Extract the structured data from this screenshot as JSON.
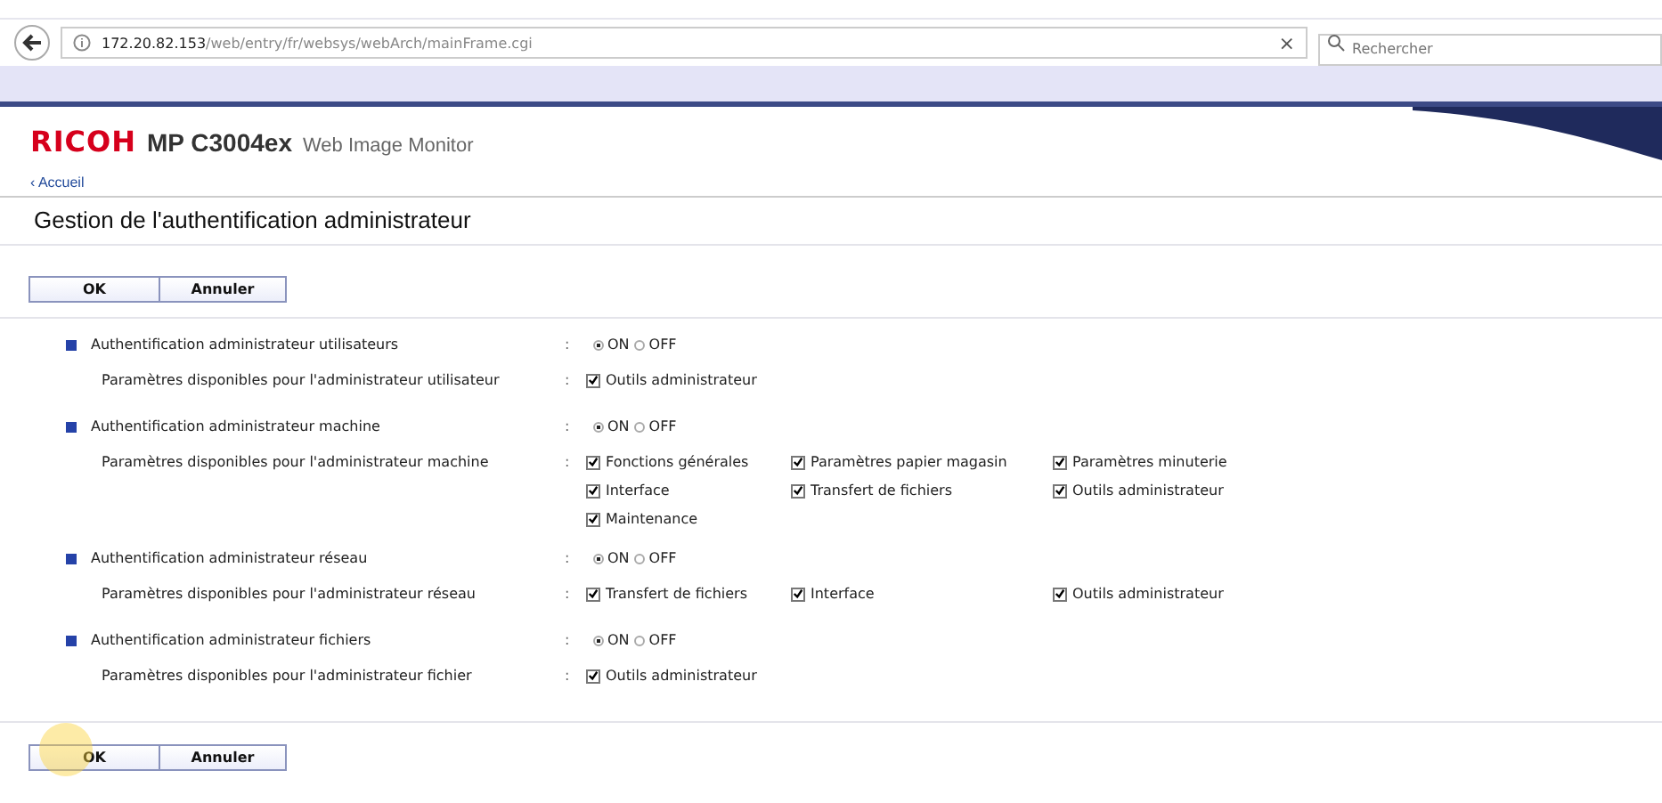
{
  "browser": {
    "url_host": "172.20.82.153",
    "url_path": "/web/entry/fr/websys/webArch/mainFrame.cgi",
    "clear": "×",
    "search_placeholder": "Rechercher"
  },
  "header": {
    "brand": "RICOH",
    "model": "MP C3004ex",
    "product": "Web Image Monitor",
    "home_link": "Accueil",
    "home_arrow": "‹"
  },
  "page_title": "Gestion de l'authentification administrateur",
  "top_buttons": [
    "OK",
    "Annuler"
  ],
  "separator": ":",
  "sections": [
    {
      "title": "Authentification administrateur utilisateurs",
      "radios": [
        {
          "label": "ON",
          "selected": true
        },
        {
          "label": "OFF",
          "selected": false
        }
      ],
      "params_label": "Paramètres disponibles pour l'administrateur utilisateur",
      "options": [
        {
          "label": "Outils administrateur",
          "checked": true
        }
      ]
    },
    {
      "title": "Authentification administrateur machine",
      "radios": [
        {
          "label": "ON",
          "selected": true
        },
        {
          "label": "OFF",
          "selected": false
        }
      ],
      "params_label": "Paramètres disponibles pour l'administrateur machine",
      "options": [
        {
          "label": "Fonctions générales",
          "checked": true
        },
        {
          "label": "Paramètres papier magasin",
          "checked": true
        },
        {
          "label": "Paramètres minuterie",
          "checked": true
        },
        {
          "label": "Interface",
          "checked": true
        },
        {
          "label": "Transfert de fichiers",
          "checked": true
        },
        {
          "label": "Outils administrateur",
          "checked": true
        },
        {
          "label": "Maintenance",
          "checked": true
        }
      ]
    },
    {
      "title": "Authentification administrateur réseau",
      "radios": [
        {
          "label": "ON",
          "selected": true
        },
        {
          "label": "OFF",
          "selected": false
        }
      ],
      "params_label": "Paramètres disponibles pour l'administrateur réseau",
      "options": [
        {
          "label": "Transfert de fichiers",
          "checked": true
        },
        {
          "label": "Interface",
          "checked": true
        },
        {
          "label": "Outils administrateur",
          "checked": true
        }
      ]
    },
    {
      "title": "Authentification administrateur fichiers",
      "radios": [
        {
          "label": "ON",
          "selected": true
        },
        {
          "label": "OFF",
          "selected": false
        }
      ],
      "params_label": "Paramètres disponibles pour l'administrateur fichier",
      "options": [
        {
          "label": "Outils administrateur",
          "checked": true
        }
      ]
    }
  ],
  "bottom_buttons": [
    "OK",
    "Annuler"
  ]
}
